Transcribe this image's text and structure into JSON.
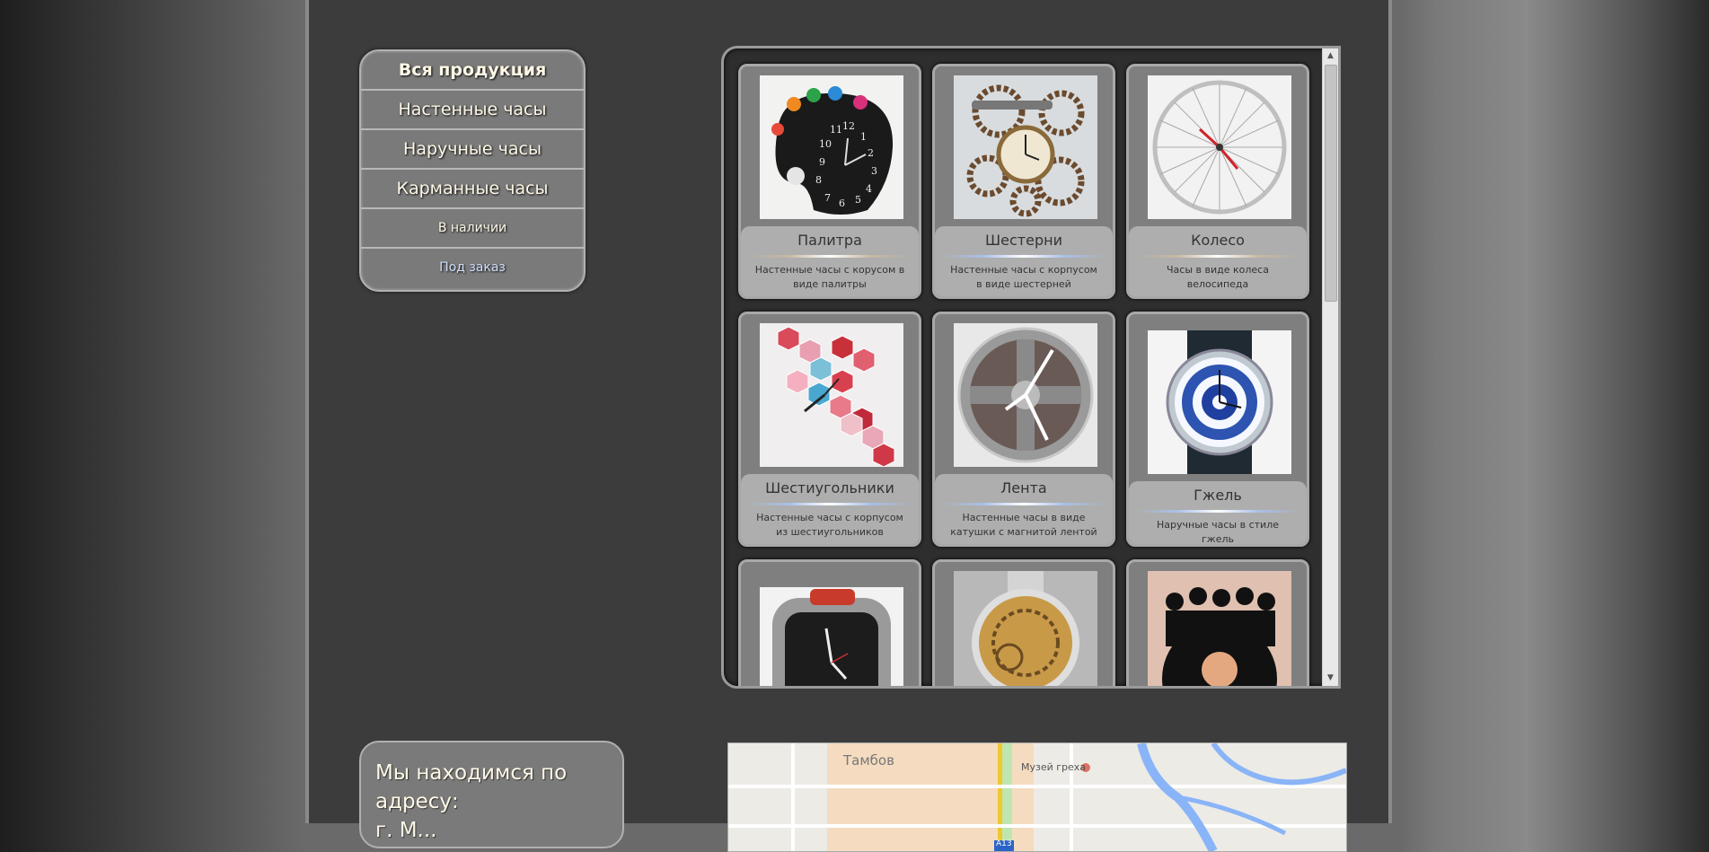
{
  "menu": {
    "items": [
      {
        "label": "Вся продукция"
      },
      {
        "label": "Настенные часы"
      },
      {
        "label": "Наручные часы"
      },
      {
        "label": "Карманные часы"
      },
      {
        "label": "В наличии"
      },
      {
        "label": "Под заказ"
      }
    ]
  },
  "products": [
    {
      "name": "Палитра",
      "desc": "Настенные часы с корусом в виде палитры"
    },
    {
      "name": "Шестерни",
      "desc": "Настенные часы с корпусом в виде шестерней"
    },
    {
      "name": "Колесо",
      "desc": "Часы в виде колеса велосипеда"
    },
    {
      "name": "Шестиугольники",
      "desc": "Настенные часы с корпусом из шестиугольников"
    },
    {
      "name": "Лента",
      "desc": "Настенные часы в виде катушки с магнитой лентой"
    },
    {
      "name": "Гжель",
      "desc": "Наручные часы в стиле гжель"
    }
  ],
  "address": {
    "heading": "Мы находимся по адресу:",
    "line": "г. М..."
  },
  "map": {
    "city_label": "Тамбов",
    "poi_label": "Музей греха",
    "road_label": "А13"
  }
}
